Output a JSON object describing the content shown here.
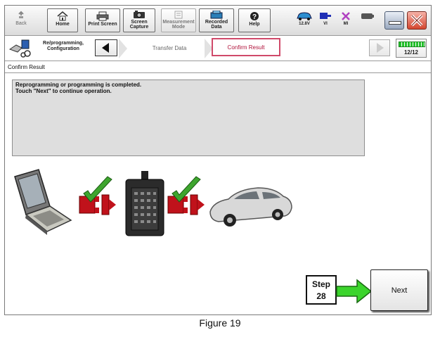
{
  "toolbar": {
    "back_label": "Back",
    "home_label": "Home",
    "print_label": "Print Screen",
    "capture_label_1": "Screen",
    "capture_label_2": "Capture",
    "measure_label_1": "Measurement",
    "measure_label_2": "Mode",
    "recorded_label_1": "Recorded",
    "recorded_label_2": "Data",
    "help_label": "Help"
  },
  "status": {
    "voltage": "12.8V",
    "vi_label": "VI",
    "mi_label": "MI"
  },
  "nav": {
    "section_label_1": "Re/programming,",
    "section_label_2": "Configuration",
    "steps": [
      "Transfer Data",
      "Confirm Result"
    ],
    "progress": "12/12",
    "progress_fraction": 1.0
  },
  "page": {
    "title": "Confirm Result",
    "message_line_1": "Reprogramming or programming is completed.",
    "message_line_2": "Touch \"Next\" to continue operation."
  },
  "step": {
    "label": "Step",
    "number": "28"
  },
  "next_button": "Next",
  "caption": "Figure 19",
  "colors": {
    "active_step_border": "#d04a6a",
    "progress_green": "#22c02a",
    "arrow_green": "#3bd42c",
    "check_green": "#3ea52e",
    "plug_red": "#c0121b"
  }
}
